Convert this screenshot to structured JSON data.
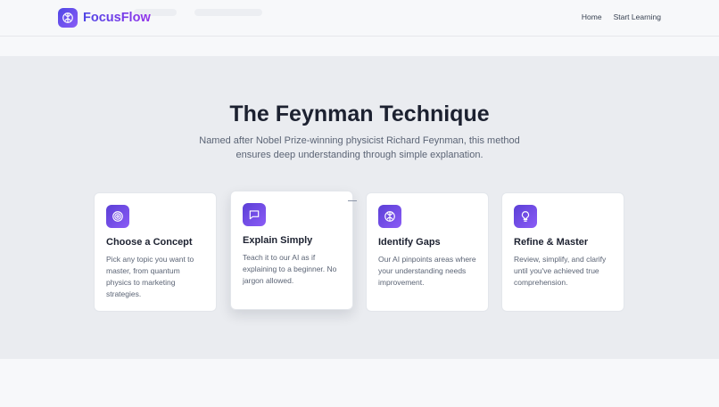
{
  "brand": {
    "name": "FocusFlow",
    "logo_icon": "brain-icon",
    "gradient": [
      "#4f46e5",
      "#9333ea"
    ]
  },
  "nav": {
    "items": [
      {
        "label": "Home"
      },
      {
        "label": "Start Learning"
      }
    ]
  },
  "hero": {
    "title": "The Feynman Technique",
    "subtitle": "Named after Nobel Prize-winning physicist Richard Feynman, this method ensures deep understanding through simple explanation."
  },
  "steps": [
    {
      "icon": "target-icon",
      "title": "Choose a Concept",
      "description": "Pick any topic you want to master, from quantum physics to marketing strategies."
    },
    {
      "icon": "chat-bubble-icon",
      "title": "Explain Simply",
      "description": "Teach it to our AI as if explaining to a beginner. No jargon allowed."
    },
    {
      "icon": "brain-icon",
      "title": "Identify Gaps",
      "description": "Our AI pinpoints areas where your understanding needs improvement."
    },
    {
      "icon": "lightbulb-icon",
      "title": "Refine & Master",
      "description": "Review, simplify, and clarify until you've achieved true comprehension."
    }
  ],
  "colors": {
    "accent": "#6d4fe0",
    "page_bg": "#f7f8fa",
    "section_bg": "#eaecf0",
    "text_dark": "#1c2130",
    "text_muted": "#5b6475"
  }
}
